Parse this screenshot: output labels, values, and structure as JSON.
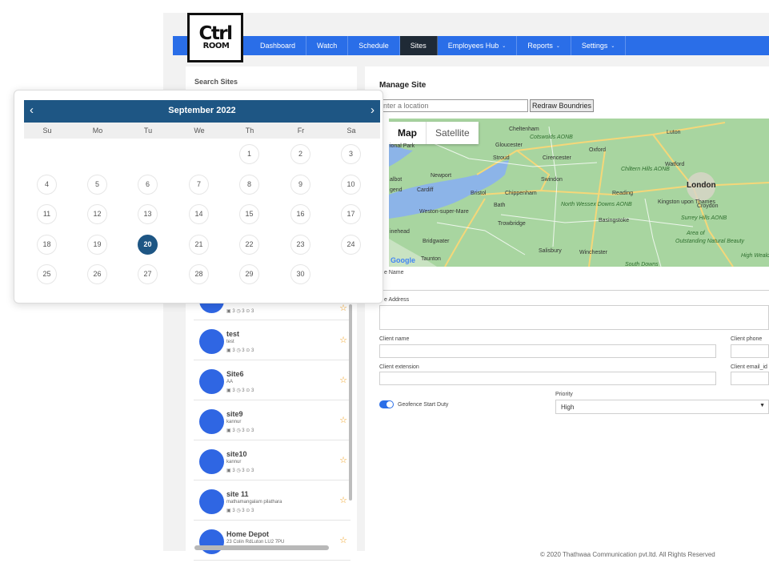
{
  "logo": {
    "line1": "Ctrl",
    "line2": "ROOM"
  },
  "nav": {
    "items": [
      {
        "label": "Dashboard",
        "caret": ""
      },
      {
        "label": "Watch",
        "caret": ""
      },
      {
        "label": "Schedule",
        "caret": ""
      },
      {
        "label": "Sites",
        "caret": "",
        "active": true
      },
      {
        "label": "Employees Hub",
        "caret": "⌄"
      },
      {
        "label": "Reports",
        "caret": "⌄"
      },
      {
        "label": "Settings",
        "caret": "⌄"
      }
    ]
  },
  "left": {
    "search_label": "Search Sites",
    "sites": [
      {
        "name": "test",
        "sub": "test",
        "meta": "▣ 3   ◷ 3   ⊙ 3"
      },
      {
        "name": "Site6",
        "sub": "AA",
        "meta": "▣ 3   ◷ 3   ⊙ 3"
      },
      {
        "name": "site9",
        "sub": "kannur",
        "meta": "▣ 3   ◷ 3   ⊙ 3"
      },
      {
        "name": "site10",
        "sub": "kannur",
        "meta": "▣ 3   ◷ 3   ⊙ 3"
      },
      {
        "name": "site 11",
        "sub": "mathamangalam pilathara",
        "meta": "▣ 3   ◷ 3   ⊙ 3"
      },
      {
        "name": "Home Depot",
        "sub": "23 Colin RdLuton LU2 7PU",
        "meta": ""
      }
    ],
    "partial_meta": "▣ 3   ◷ 3   ⊙ 3"
  },
  "manage": {
    "title": "Manage Site",
    "location_placeholder": "nter a location",
    "redraw_label": "Redraw Boundries",
    "map_tab_map": "Map",
    "map_tab_satellite": "Satellite",
    "google": "Google",
    "site_name_label": "e Name",
    "site_address_label": "e Address",
    "client_name_label": "Client name",
    "client_phone_label": "Client phone",
    "client_extension_label": "Client extension",
    "client_email_label": "Client email_id",
    "geofence_label": "Geofence Start Duty",
    "priority_label": "Priority",
    "priority_value": "High"
  },
  "map_labels": [
    "Cheltenham",
    "Luton",
    "Gloucester",
    "Cotswolds AONB",
    "Oxford",
    "Stroud",
    "Cirencester",
    "Chiltern Hills AONB",
    "Watford",
    "Newport",
    "Swindon",
    "London",
    "Cardiff",
    "Bristol",
    "Chippenham",
    "Reading",
    "Weston-super-Mare",
    "Bath",
    "North Wessex Downs AONB",
    "Kingston upon Thames",
    "Croydon",
    "Trowbridge",
    "Basingstoke",
    "Surrey Hills AONB",
    "Bridgwater",
    "High Weald AONB",
    "Salisbury",
    "Winchester",
    "Taunton",
    "South Downs",
    "Outstanding Natural Beauty",
    "Area of",
    "ional Park",
    "albot",
    "gend",
    "inehead"
  ],
  "calendar": {
    "month_label": "September 2022",
    "prev": "‹",
    "next": "›",
    "dow": [
      "Su",
      "Mo",
      "Tu",
      "We",
      "Th",
      "Fr",
      "Sa"
    ],
    "first_weekday": 4,
    "days_in_month": 30,
    "selected_day": 20
  },
  "footer": "© 2020 Thathwaa Communication pvt.ltd. All Rights Reserved"
}
